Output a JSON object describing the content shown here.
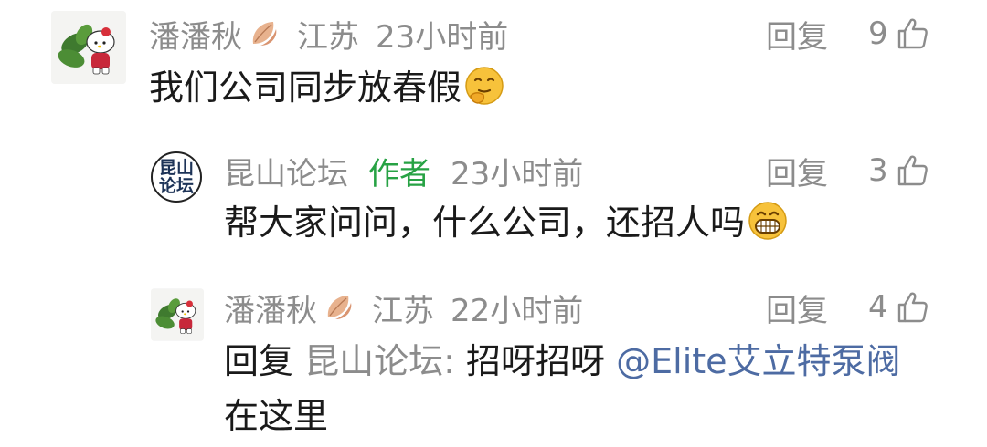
{
  "comments": [
    {
      "username": "潘潘秋",
      "location": "江苏",
      "time": "23小时前",
      "reply_label": "回复",
      "likes": "9",
      "text": "我们公司同步放春假",
      "avatar_icon": "hello-kitty-avatar",
      "emoji_icon": "thinking-face-emoji"
    },
    {
      "username": "昆山论坛",
      "author_tag": "作者",
      "time": "23小时前",
      "reply_label": "回复",
      "likes": "3",
      "text": "帮大家问问，什么公司，还招人吗",
      "avatar_text": "昆山论坛",
      "emoji_icon": "grinning-face-emoji"
    },
    {
      "username": "潘潘秋",
      "location": "江苏",
      "time": "22小时前",
      "reply_label": "回复",
      "likes": "4",
      "reply_prefix": "回复",
      "reply_to": "昆山论坛:",
      "text": "招呀招呀",
      "mention": "@Elite艾立特泵阀",
      "text_line2": "在这里",
      "avatar_icon": "hello-kitty-avatar"
    }
  ],
  "colors": {
    "meta_gray": "#8c8c8c",
    "author_green": "#27a244",
    "mention_blue": "#4d6ba3",
    "body_text": "#1a1a1a"
  }
}
